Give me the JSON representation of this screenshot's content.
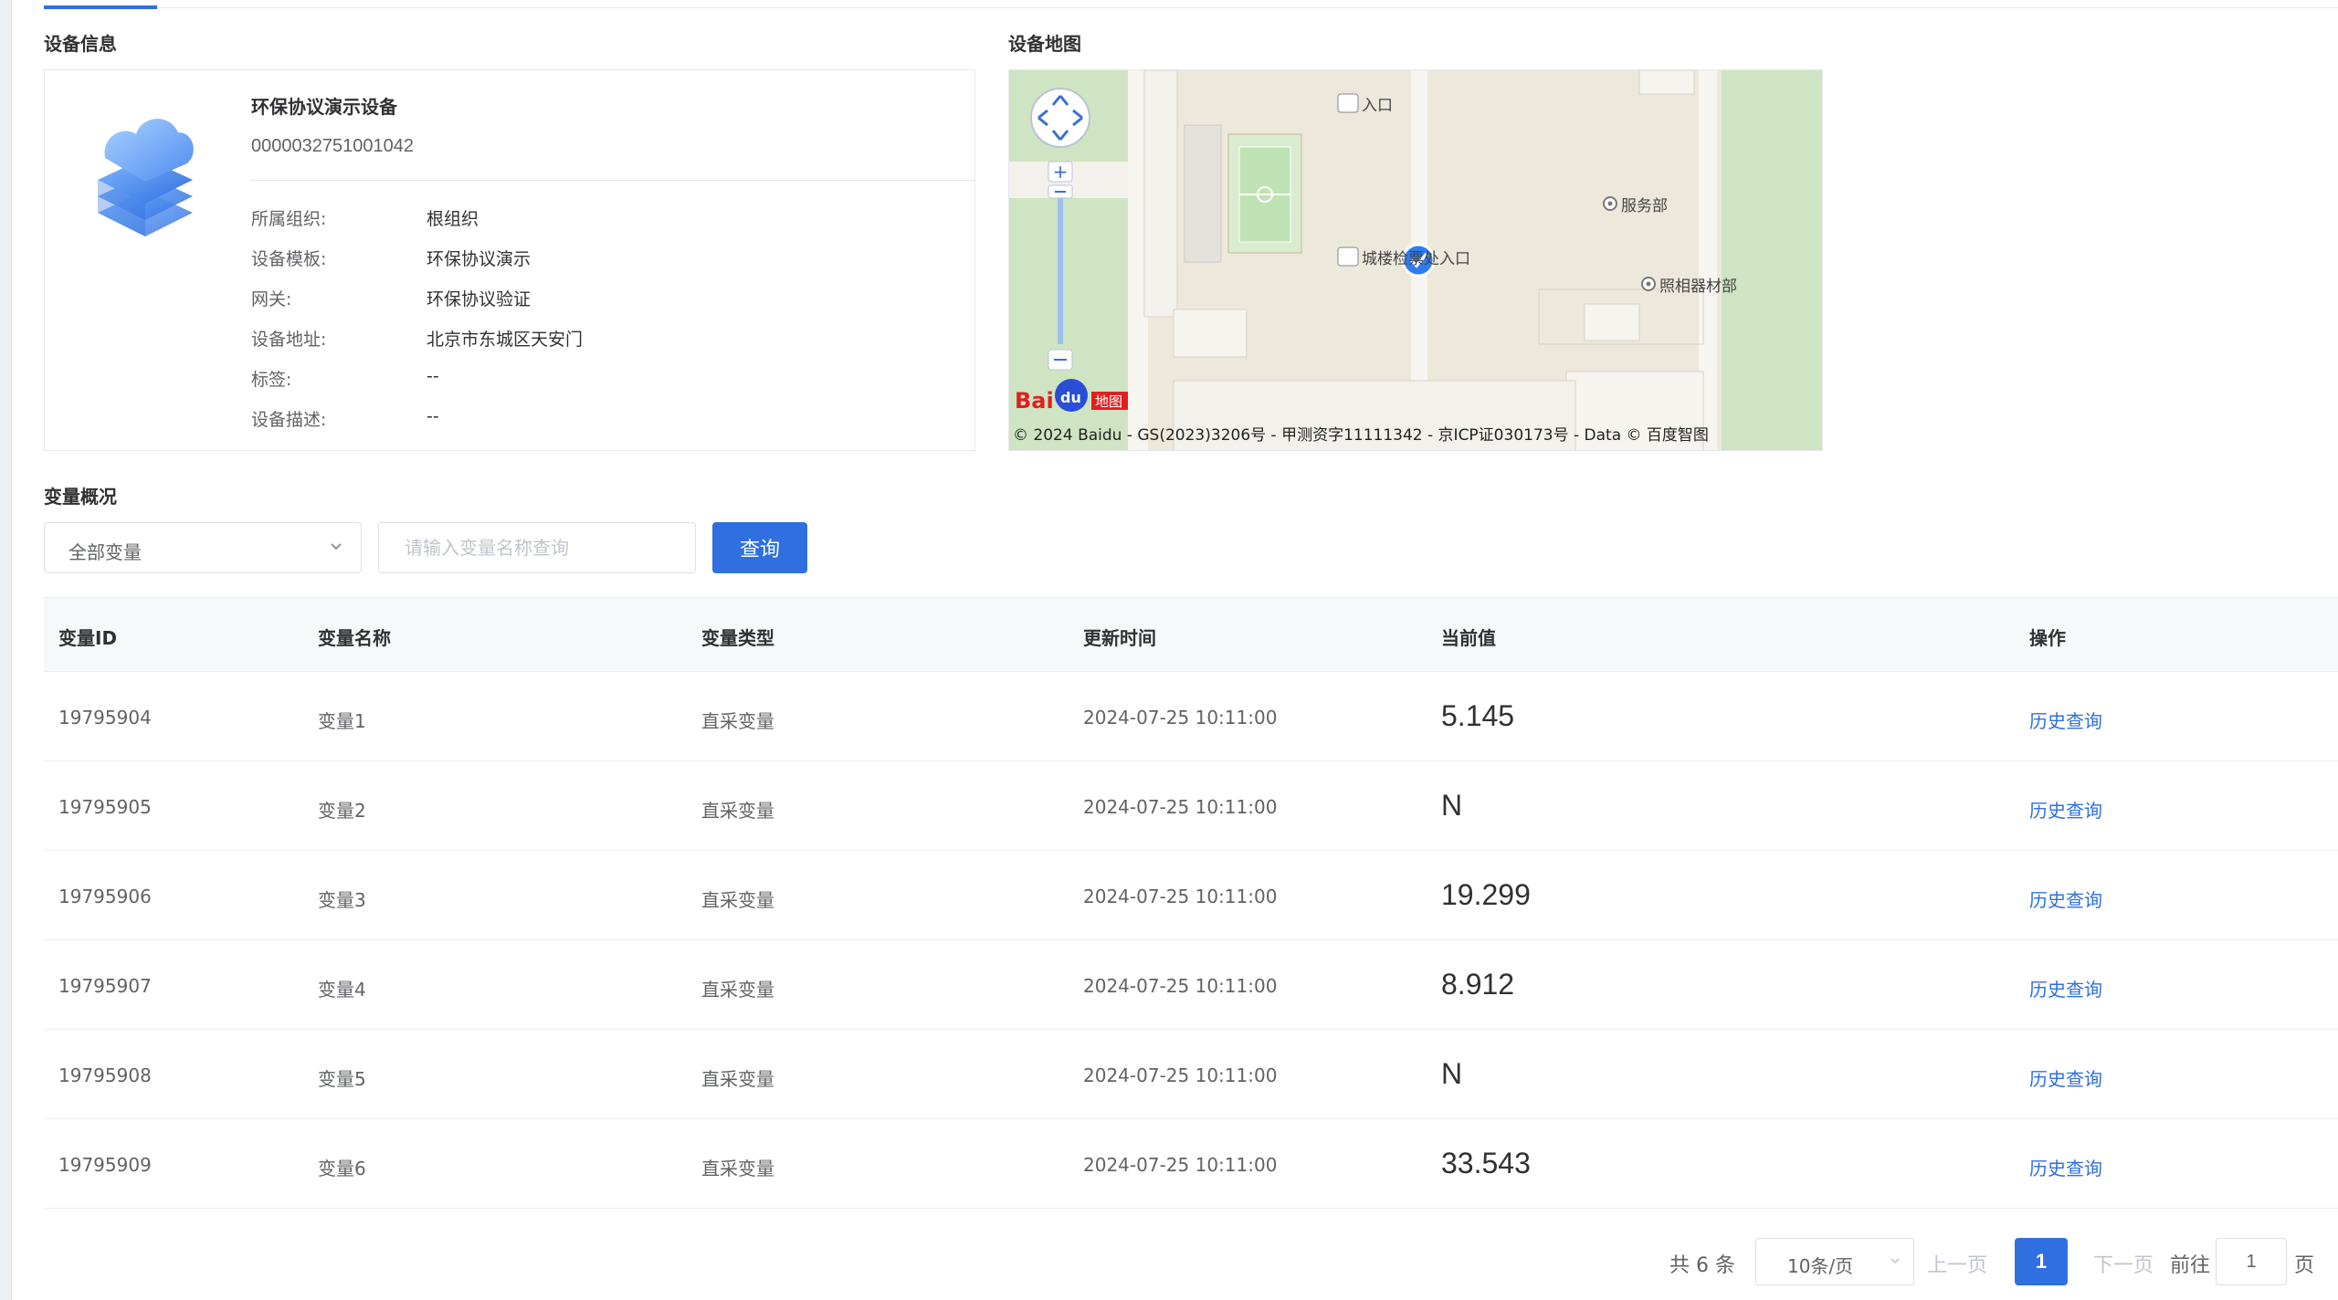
{
  "device_info": {
    "section_title": "设备信息",
    "name": "环保协议演示设备",
    "serial": "0000032751001042",
    "fields": [
      {
        "label": "所属组织:",
        "value": "根组织"
      },
      {
        "label": "设备模板:",
        "value": "环保协议演示"
      },
      {
        "label": "网关:",
        "value": "环保协议验证"
      },
      {
        "label": "设备地址:",
        "value": "北京市东城区天安门"
      },
      {
        "label": "标签:",
        "value": "--"
      },
      {
        "label": "设备描述:",
        "value": "--"
      }
    ]
  },
  "device_map": {
    "section_title": "设备地图",
    "copyright": "© 2024 Baidu - GS(2023)3206号 - 甲测资字11111342 - 京ICP证030173号 - Data © 百度智图",
    "labels": [
      "入口",
      "服务部",
      "城楼检票处入口",
      "照相器材部"
    ]
  },
  "variables": {
    "section_title": "变量概况",
    "filter_select": "全部变量",
    "search_placeholder": "请输入变量名称查询",
    "query_button": "查询",
    "columns": [
      "变量ID",
      "变量名称",
      "变量类型",
      "更新时间",
      "当前值",
      "操作"
    ],
    "rows": [
      {
        "id": "19795904",
        "name": "变量1",
        "type": "直采变量",
        "time": "2024-07-25 10:11:00",
        "value": "5.145",
        "action": "历史查询"
      },
      {
        "id": "19795905",
        "name": "变量2",
        "type": "直采变量",
        "time": "2024-07-25 10:11:00",
        "value": "N",
        "action": "历史查询"
      },
      {
        "id": "19795906",
        "name": "变量3",
        "type": "直采变量",
        "time": "2024-07-25 10:11:00",
        "value": "19.299",
        "action": "历史查询"
      },
      {
        "id": "19795907",
        "name": "变量4",
        "type": "直采变量",
        "time": "2024-07-25 10:11:00",
        "value": "8.912",
        "action": "历史查询"
      },
      {
        "id": "19795908",
        "name": "变量5",
        "type": "直采变量",
        "time": "2024-07-25 10:11:00",
        "value": "N",
        "action": "历史查询"
      },
      {
        "id": "19795909",
        "name": "变量6",
        "type": "直采变量",
        "time": "2024-07-25 10:11:00",
        "value": "33.543",
        "action": "历史查询"
      }
    ]
  },
  "pagination": {
    "total": "共 6 条",
    "page_size": "10条/页",
    "prev": "上一页",
    "current_page": "1",
    "next": "下一页",
    "goto_label": "前往",
    "goto_value": "1",
    "goto_unit": "页"
  },
  "colors": {
    "primary": "#2f6fe0",
    "border": "#e4e7ed",
    "header_bg": "#f7f8fa"
  }
}
